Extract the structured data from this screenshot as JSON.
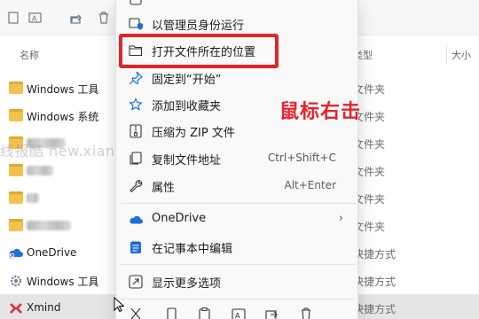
{
  "columns": {
    "name": "名称",
    "type": "类型",
    "size": "大小"
  },
  "files": [
    {
      "name": "Windows 工具",
      "type": "文件夹",
      "icon": "folder-icon"
    },
    {
      "name": "Windows 系统",
      "type": "文件夹",
      "icon": "folder-icon"
    },
    {
      "name": "",
      "type": "文件夹",
      "icon": "folder-icon"
    },
    {
      "name": "",
      "type": "文件夹",
      "icon": "folder-icon"
    },
    {
      "name": "",
      "type": "文件夹",
      "icon": "folder-icon"
    },
    {
      "name": "",
      "type": "文件夹",
      "icon": "folder-icon"
    },
    {
      "name": "OneDrive",
      "type": "快捷方式",
      "icon": "onedrive-shortcut-icon"
    },
    {
      "name": "Windows 工具",
      "type": "快捷方式",
      "icon": "settings-shortcut-icon"
    },
    {
      "name": "Xmind",
      "type": "快捷方式",
      "icon": "xmind-icon"
    }
  ],
  "menu": {
    "items": [
      {
        "label": "以管理员身份运行",
        "icon": "shield-icon",
        "shortcut": ""
      },
      {
        "label": "打开文件所在的位置",
        "icon": "folder-open-icon",
        "shortcut": ""
      },
      {
        "label": "固定到“开始”",
        "icon": "pin-icon",
        "shortcut": ""
      },
      {
        "label": "添加到收藏夹",
        "icon": "star-icon",
        "shortcut": ""
      },
      {
        "label": "压缩为 ZIP 文件",
        "icon": "zip-icon",
        "shortcut": ""
      },
      {
        "label": "复制文件地址",
        "icon": "copy-path-icon",
        "shortcut": "Ctrl+Shift+C"
      },
      {
        "label": "属性",
        "icon": "wrench-icon",
        "shortcut": "Alt+Enter"
      },
      {
        "label": "OneDrive",
        "icon": "cloud-icon",
        "shortcut": ""
      },
      {
        "label": "在记事本中编辑",
        "icon": "notepad-icon",
        "shortcut": ""
      },
      {
        "label": "显示更多选项",
        "icon": "more-options-icon",
        "shortcut": ""
      }
    ]
  },
  "annotation": "鼠标右击",
  "watermark": "线报酷 new.xianbao.fun",
  "colors": {
    "highlight": "#e3242b",
    "folder": "#f2c14e",
    "accent": "#1f6fd6"
  }
}
